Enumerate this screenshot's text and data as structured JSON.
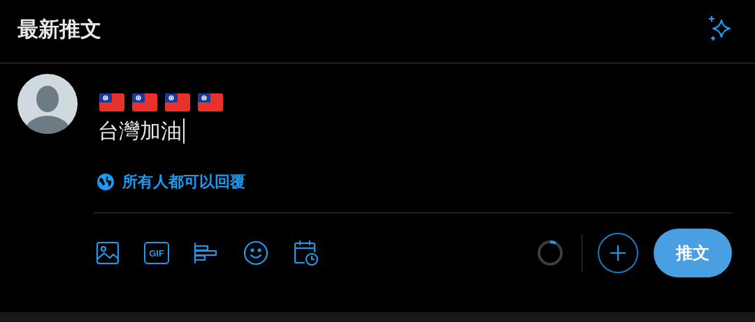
{
  "header": {
    "title": "最新推文"
  },
  "composer": {
    "emoji": [
      {
        "kind": "flag"
      },
      {
        "kind": "flag"
      },
      {
        "kind": "flag"
      },
      {
        "kind": "flag"
      }
    ],
    "value": "台灣加油",
    "reply_setting": "所有人都可以回覆",
    "toolbar": [
      {
        "kind": "image"
      },
      {
        "kind": "gif",
        "label": "GIF"
      },
      {
        "kind": "poll"
      },
      {
        "kind": "emoji"
      },
      {
        "kind": "schedule"
      }
    ],
    "submit": "推文"
  }
}
